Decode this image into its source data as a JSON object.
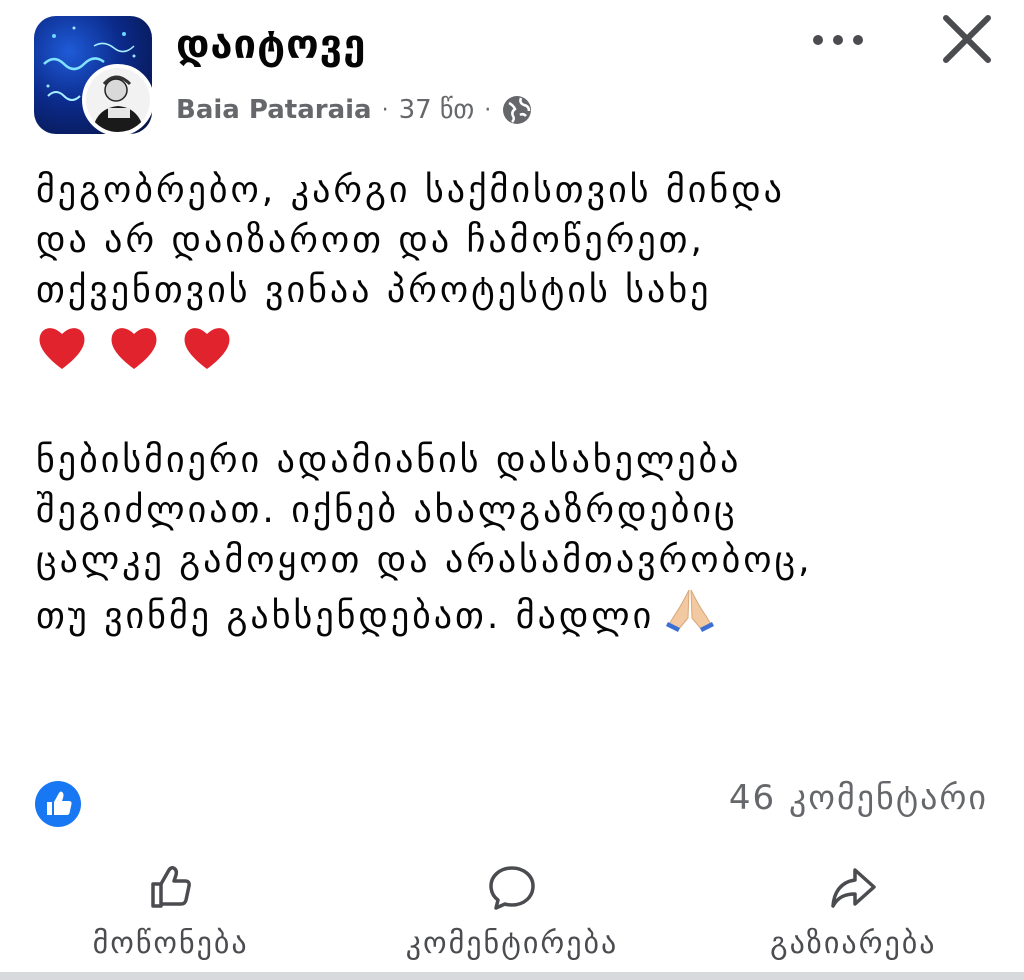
{
  "header": {
    "group_name": "დაიტოვე",
    "author": "Baia Pataraia",
    "separator": "·",
    "time": "37 წთ"
  },
  "post": {
    "lines": [
      "მეგობრებო, კარგი საქმისთვის მინდა",
      "და არ დაიზაროთ და ჩამოწერეთ,",
      "თქვენთვის ვინაა პროტესტის სახე"
    ],
    "lines2": [
      "ნებისმიერი ადამიანის დასახელება",
      "შეგიძლიათ. იქნებ ახალგაზრდებიც",
      "ცალკე გამოყოთ და არასამთავრობოც,",
      "თუ ვინმე გახსენდებათ. მადლი"
    ],
    "heart_count": 3,
    "heart_color": "#e0232c"
  },
  "stats": {
    "comments": "46 კომენტარი",
    "reaction_color": "#1877f2"
  },
  "actions": {
    "like": "მოწონება",
    "comment": "კომენტირება",
    "share": "გაზიარება"
  },
  "icons": [
    "like-reaction-icon",
    "globe-icon",
    "more-options-icon",
    "close-icon",
    "heart-icon",
    "pray-icon",
    "like-icon",
    "comment-icon",
    "share-icon"
  ]
}
